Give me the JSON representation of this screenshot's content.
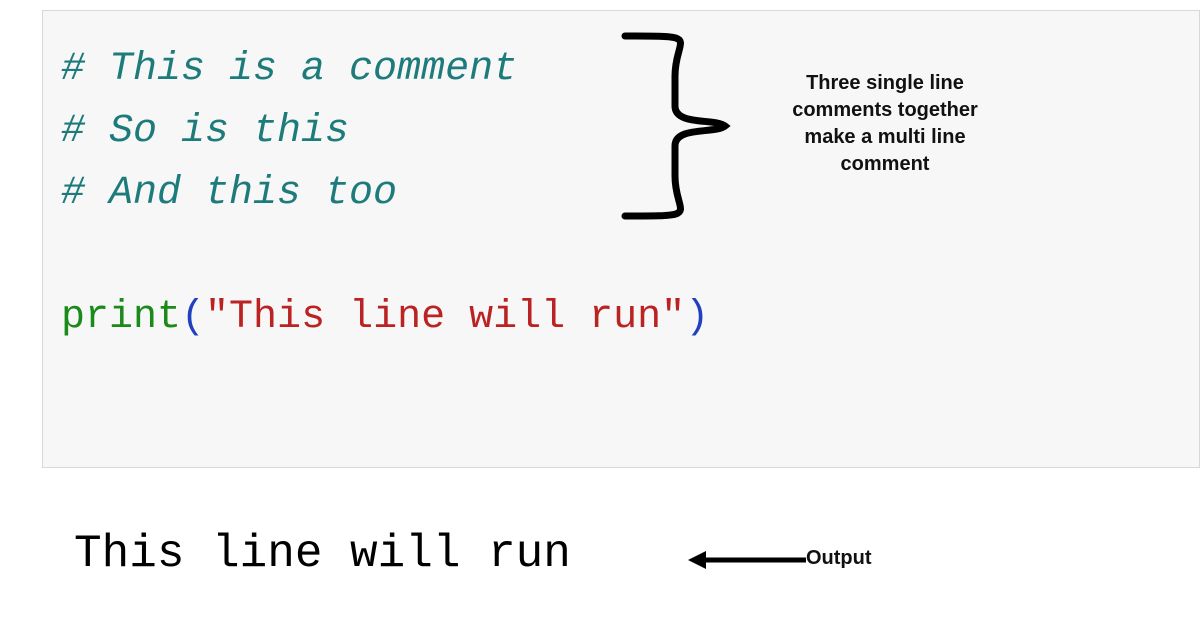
{
  "code": {
    "comment1": "# This is a comment",
    "comment2": "# So is this",
    "comment3": "# And this too",
    "print_fn": "print",
    "print_open": "(",
    "print_str": "\"This line will run\"",
    "print_close": ")"
  },
  "annotations": {
    "brace_text": "Three single line comments together make a multi line comment",
    "output_label": "Output"
  },
  "output": {
    "text": "This line will run"
  }
}
